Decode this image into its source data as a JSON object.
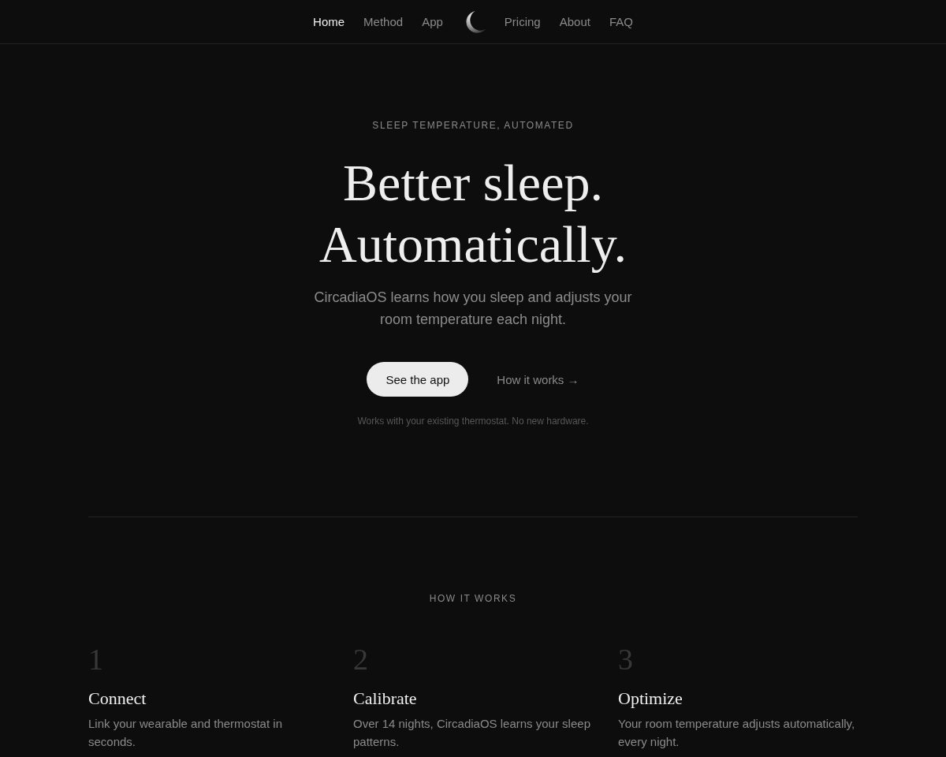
{
  "nav": {
    "links_left": [
      {
        "label": "Home",
        "selected": true
      },
      {
        "label": "Method",
        "selected": false
      },
      {
        "label": "App",
        "selected": false
      }
    ],
    "links_right": [
      {
        "label": "Pricing",
        "selected": false
      },
      {
        "label": "About",
        "selected": false
      },
      {
        "label": "FAQ",
        "selected": false
      }
    ]
  },
  "hero": {
    "eyebrow": "SLEEP TEMPERATURE, AUTOMATED",
    "heading_lines": [
      "Better sleep.",
      "Automatically."
    ],
    "lead": "CircadiaOS learns how you sleep and adjusts your room temperature each night.",
    "primary_button": "See the app",
    "secondary_link": "How it works →",
    "note": "Works with your existing thermostat. No new hardware."
  },
  "how_it_works": {
    "label": "HOW IT WORKS",
    "steps": [
      {
        "number": "1",
        "title": "Connect",
        "description": "Link your wearable and thermostat in seconds."
      },
      {
        "number": "2",
        "title": "Calibrate",
        "description": "Over 14 nights, CircadiaOS learns your sleep patterns."
      },
      {
        "number": "3",
        "title": "Optimize",
        "description": "Your room temperature adjusts automatically, every night."
      }
    ]
  }
}
